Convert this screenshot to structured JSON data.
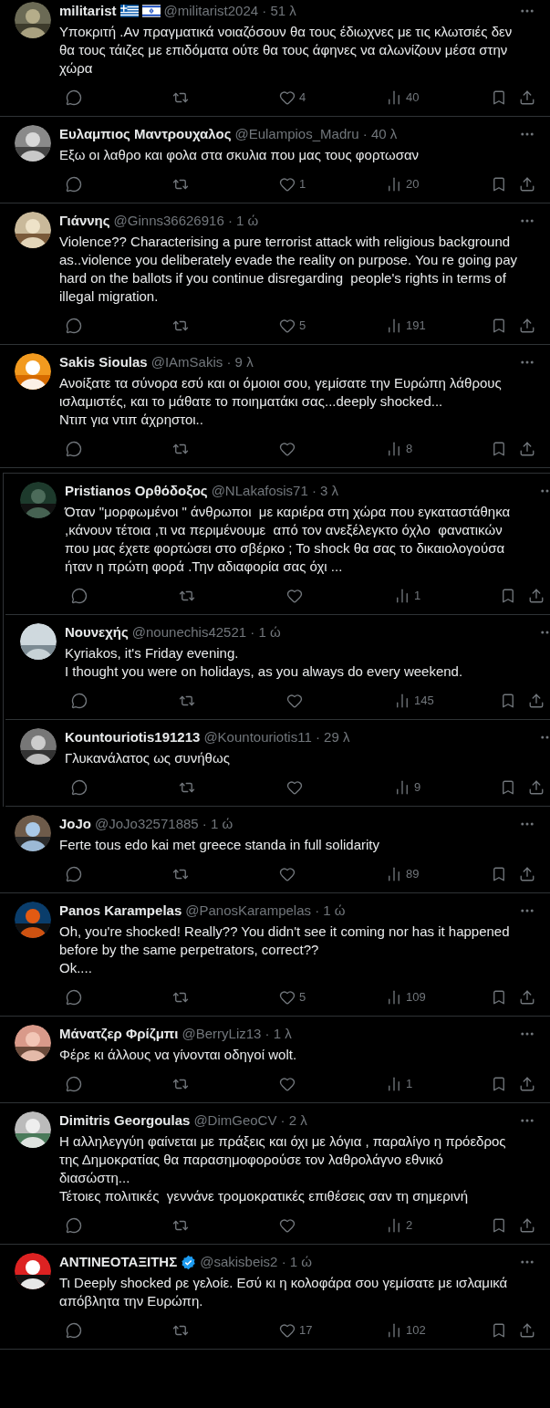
{
  "sections": [
    {
      "kind": "plain",
      "tweets": [
        {
          "name": "militarist",
          "name_icons": [
            {
              "kind": "greece-flag"
            },
            {
              "kind": "israel-flag"
            }
          ],
          "verified": false,
          "meta": "@militarist2024 · 51 λ",
          "lines": [
            "Υποκριτή .Αν πραγματικά νοιαζόσουν θα τους έδιωχνες με τις κλωτσιές δεν",
            "θα τους τάιζες με επιδόματα ούτε θα τους άφηνες να αλωνίζουν μέσα στην",
            "χώρα"
          ],
          "likes": "4",
          "views": "40"
        },
        {
          "name": "Ευλαμπιος Μαντρουχαλος",
          "verified": false,
          "meta": "@Eulampios_Madru · 40 λ",
          "lines": [
            "Εξω οι λαθρο και φολα στα σκυλια που μας τους φορτωσαν"
          ],
          "likes": "1",
          "views": "20"
        },
        {
          "name": "Γιάννης",
          "verified": false,
          "meta": "@Ginns36626916 · 1 ώ",
          "lines": [
            "Violence?? Characterising a pure terrorist attack with religious background",
            "as..violence you deliberately evade the reality on purpose. You re going pay",
            "hard on the ballots if you continue disregarding  people's rights in terms of",
            "illegal migration."
          ],
          "likes": "5",
          "views": "191"
        },
        {
          "name": "Sakis Sioulas",
          "verified": false,
          "meta": "@IAmSakis · 9 λ",
          "lines": [
            "Ανοίξατε τα σύνορα εσύ και οι όμοιοι σου, γεμίσατε την Ευρώπη λάθρους",
            "ισλαμιστές, και το μάθατε το ποιηματάκι σας...deeply shocked...",
            "Ντιπ για ντιπ άχρηστοι.."
          ],
          "views": "8"
        }
      ]
    },
    {
      "kind": "cropped",
      "tweets": [
        {
          "name": "Pristianos Ορθόδοξος",
          "verified": false,
          "meta": "@NLakafosis71 · 3 λ",
          "lines": [
            "Όταν \"μορφωμένοι \" άνθρωποι  με καριέρα στη χώρα που εγκαταστάθηκα",
            ",κάνουν τέτοια ,τι να περιμένουμε  από τον ανεξέλεγκτο όχλο  φανατικών",
            "που μας έχετε φορτώσει στο σβέρκο ; Το shock θα σας το δικαιολογούσα",
            "ήταν η πρώτη φορά .Την αδιαφορία σας όχι ..."
          ],
          "views": "1"
        },
        {
          "name": "Νουνεχής",
          "verified": false,
          "meta": "@nounechis42521 · 1 ώ",
          "lines": [
            "Kyriakos, it's Friday evening.",
            "I thought you were on holidays, as you always do every weekend."
          ],
          "views": "145"
        },
        {
          "name": "Kountouriotis191213",
          "verified": false,
          "meta": "@Kountouriotis11 · 29 λ",
          "lines": [
            "Γλυκανάλατος ως συνήθως"
          ],
          "views": "9"
        }
      ]
    },
    {
      "kind": "plain",
      "tweets": [
        {
          "name": "JoJo",
          "verified": false,
          "meta": "@JoJo32571885 · 1 ώ",
          "lines": [
            "Ferte tous edo kai met greece standa in full solidarity"
          ],
          "views": "89"
        },
        {
          "name": "Panos Karampelas",
          "verified": false,
          "meta": "@PanosKarampelas · 1 ώ",
          "lines": [
            "Oh, you're shocked! Really?? You didn't see it coming nor has it happened",
            "before by the same perpetrators, correct??",
            "Ok...."
          ],
          "likes": "5",
          "views": "109"
        },
        {
          "name": "Μάνατζερ Φρίζμπι",
          "verified": false,
          "meta": "@BerryLiz13 · 1 λ",
          "lines": [
            "Φέρε κι άλλους να γίνονται οδηγοί wolt."
          ],
          "views": "1"
        },
        {
          "name": "Dimitris Georgoulas",
          "verified": false,
          "meta": "@DimGeoCV · 2 λ",
          "lines": [
            "Η αλληλεγγύη φαίνεται με πράξεις και όχι με λόγια , παραλίγο η πρόεδρος",
            "της Δημοκρατίας θα παρασημοφορούσε τον λαθρολάγνο εθνικό",
            "διασώστη...",
            "Τέτοιες πολιτικές  γεννάνε τρομοκρατικές επιθέσεις σαν τη σημερινή"
          ],
          "views": "2"
        },
        {
          "name": "ΑΝΤΙΝΕΟΤΑΞΙΤΗΣ",
          "verified": true,
          "meta": "@sakisbeis2 · 1 ώ",
          "lines": [
            "Τι Deeply shocked ρε γελοίε. Εσύ κι η κολοφάρα σου γεμίσατε με ισλαμικά",
            "απόβλητα την Ευρώπη."
          ],
          "likes": "17",
          "views": "102"
        }
      ]
    }
  ]
}
